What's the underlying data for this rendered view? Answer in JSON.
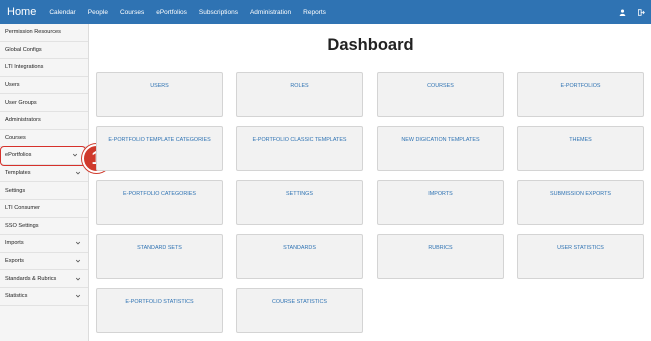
{
  "navbar": {
    "brand": "Home",
    "links": [
      "Calendar",
      "People",
      "Courses",
      "ePortfolios",
      "Subscriptions",
      "Administration",
      "Reports"
    ],
    "icons": [
      "user-icon",
      "sign-out-icon"
    ],
    "background": "#2f73b3"
  },
  "sidebar": {
    "items": [
      {
        "label": "Permission Resources",
        "chevron": false
      },
      {
        "label": "Global Configs",
        "chevron": false
      },
      {
        "label": "LTI Integrations",
        "chevron": false
      },
      {
        "label": "Users",
        "chevron": false
      },
      {
        "label": "User Groups",
        "chevron": false
      },
      {
        "label": "Administrators",
        "chevron": false
      },
      {
        "label": "Courses",
        "chevron": false
      },
      {
        "label": "ePortfolios",
        "chevron": true
      },
      {
        "label": "Templates",
        "chevron": true
      },
      {
        "label": "Settings",
        "chevron": false
      },
      {
        "label": "LTI Consumer",
        "chevron": false
      },
      {
        "label": "SSO Settings",
        "chevron": false
      },
      {
        "label": "Imports",
        "chevron": true
      },
      {
        "label": "Exports",
        "chevron": true
      },
      {
        "label": "Standards & Rubrics",
        "chevron": true
      },
      {
        "label": "Statistics",
        "chevron": true
      }
    ],
    "highlighted": "ePortfolios"
  },
  "callout": {
    "number": "1",
    "color": "#cf3a2c"
  },
  "main": {
    "title": "Dashboard",
    "tiles": [
      "USERS",
      "ROLES",
      "COURSES",
      "E-PORTFOLIOS",
      "E-PORTFOLIO TEMPLATE CATEGORIES",
      "E-PORTFOLIO CLASSIC TEMPLATES",
      "NEW DIGICATION TEMPLATES",
      "THEMES",
      "E-PORTFOLIO CATEGORIES",
      "SETTINGS",
      "IMPORTS",
      "SUBMISSION EXPORTS",
      "STANDARD SETS",
      "STANDARDS",
      "RUBRICS",
      "USER STATISTICS",
      "E-PORTFOLIO STATISTICS",
      "COURSE STATISTICS"
    ],
    "tile_text_color": "#2f73b3"
  }
}
